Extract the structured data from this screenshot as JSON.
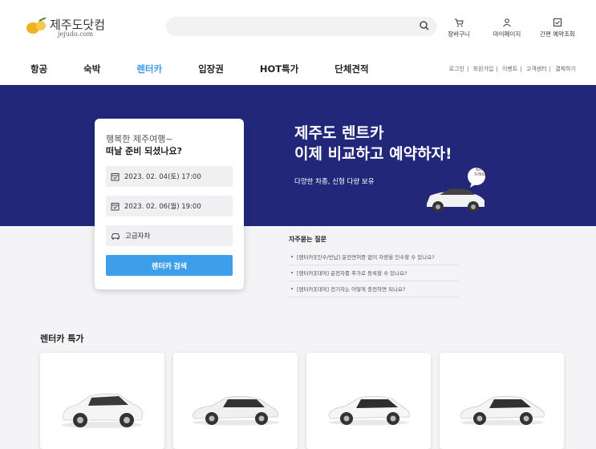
{
  "header": {
    "logo_name": "제주도닷컴",
    "logo_sub": "jejudo.com",
    "search_placeholder": "",
    "utils": [
      "장바구니",
      "마이페이지",
      "간편 예약조회"
    ]
  },
  "nav": [
    "항공",
    "숙박",
    "렌터카",
    "입장권",
    "HOT특가",
    "단체견적"
  ],
  "links": [
    "로그인",
    "회원가입",
    "이벤트",
    "고객센터",
    "결제하기"
  ],
  "banner": {
    "title_line1": "제주도 렌트카",
    "title_line2": "이제 비교하고 예약하자!",
    "subtitle": "다양한 차종, 신형 다량 보유",
    "badge": "최저가\n가격비교"
  },
  "search_card": {
    "greeting": "행복한 제주여행~",
    "prompt": "떠날 준비 되셨나요?",
    "pickup": "2023. 02. 04(토) 17:00",
    "return": "2023. 02. 06(월) 19:00",
    "car_type": "고급자차",
    "button": "렌터카 검색"
  },
  "faq": {
    "title": "자주묻는 질문",
    "items": [
      "[렌터카][인수/반납] 운전면허증 없이 차량을 인수할 수 있나요?",
      "[렌터카][대여] 운전자를 추가로 등록할 수 있나요?",
      "[렌터카][대여] 전기차는 어떻게 충전하면 되나요?"
    ]
  },
  "deals_title": "렌터카 특가",
  "colors": {
    "banner": "#22277a",
    "accent": "#3a9be6",
    "button": "#3d9fe9"
  }
}
